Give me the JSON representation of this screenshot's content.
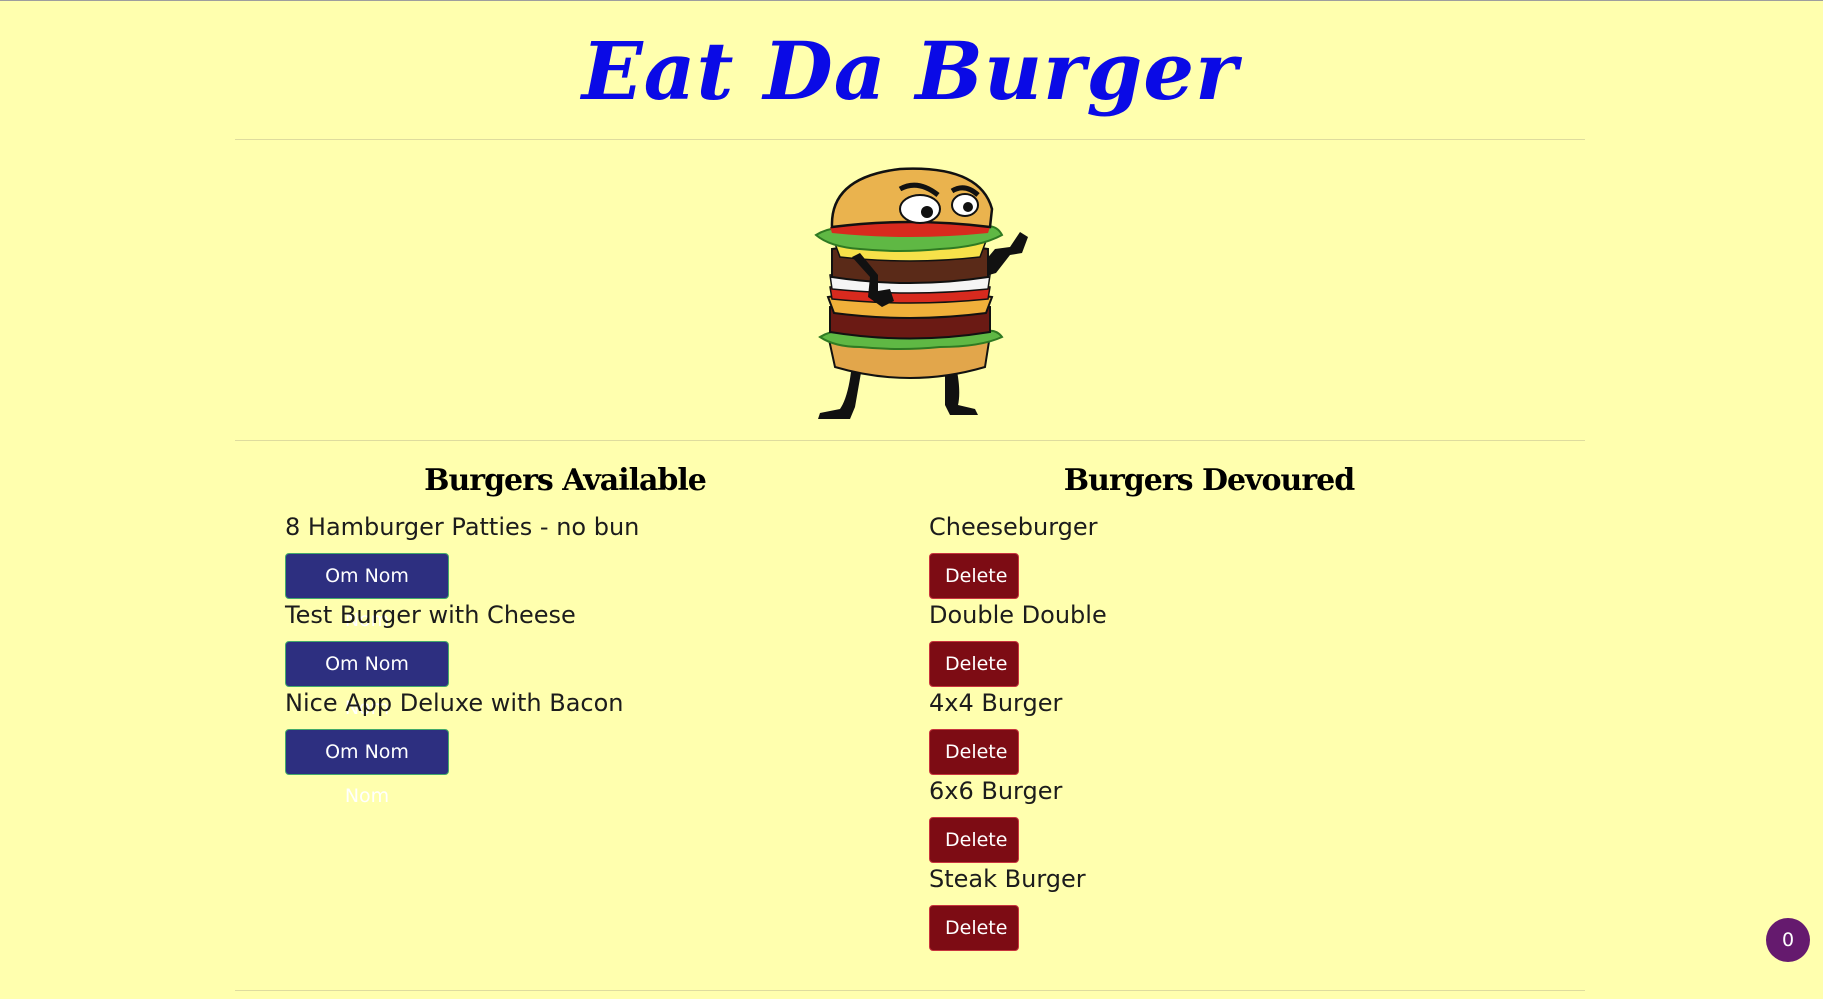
{
  "header": {
    "title": "Eat Da Burger"
  },
  "mascot": {
    "icon": "burger-mascot-icon"
  },
  "available": {
    "heading": "Burgers Available",
    "button_label": "Om Nom Nom",
    "items": [
      {
        "name": "8 Hamburger Patties - no bun"
      },
      {
        "name": "Test Burger with Cheese"
      },
      {
        "name": "Nice App Deluxe with Bacon"
      }
    ]
  },
  "devoured": {
    "heading": "Burgers Devoured",
    "button_label": "Delete",
    "items": [
      {
        "name": "Cheeseburger"
      },
      {
        "name": "Double Double"
      },
      {
        "name": "4x4 Burger"
      },
      {
        "name": "6x6 Burger"
      },
      {
        "name": "Steak Burger"
      }
    ]
  },
  "badge": {
    "count": "0"
  },
  "colors": {
    "background": "#ffffae",
    "title": "#0a0ae6",
    "eat_button": "#2d2f80",
    "delete_button": "#7d0c14",
    "badge": "#651a6e"
  }
}
